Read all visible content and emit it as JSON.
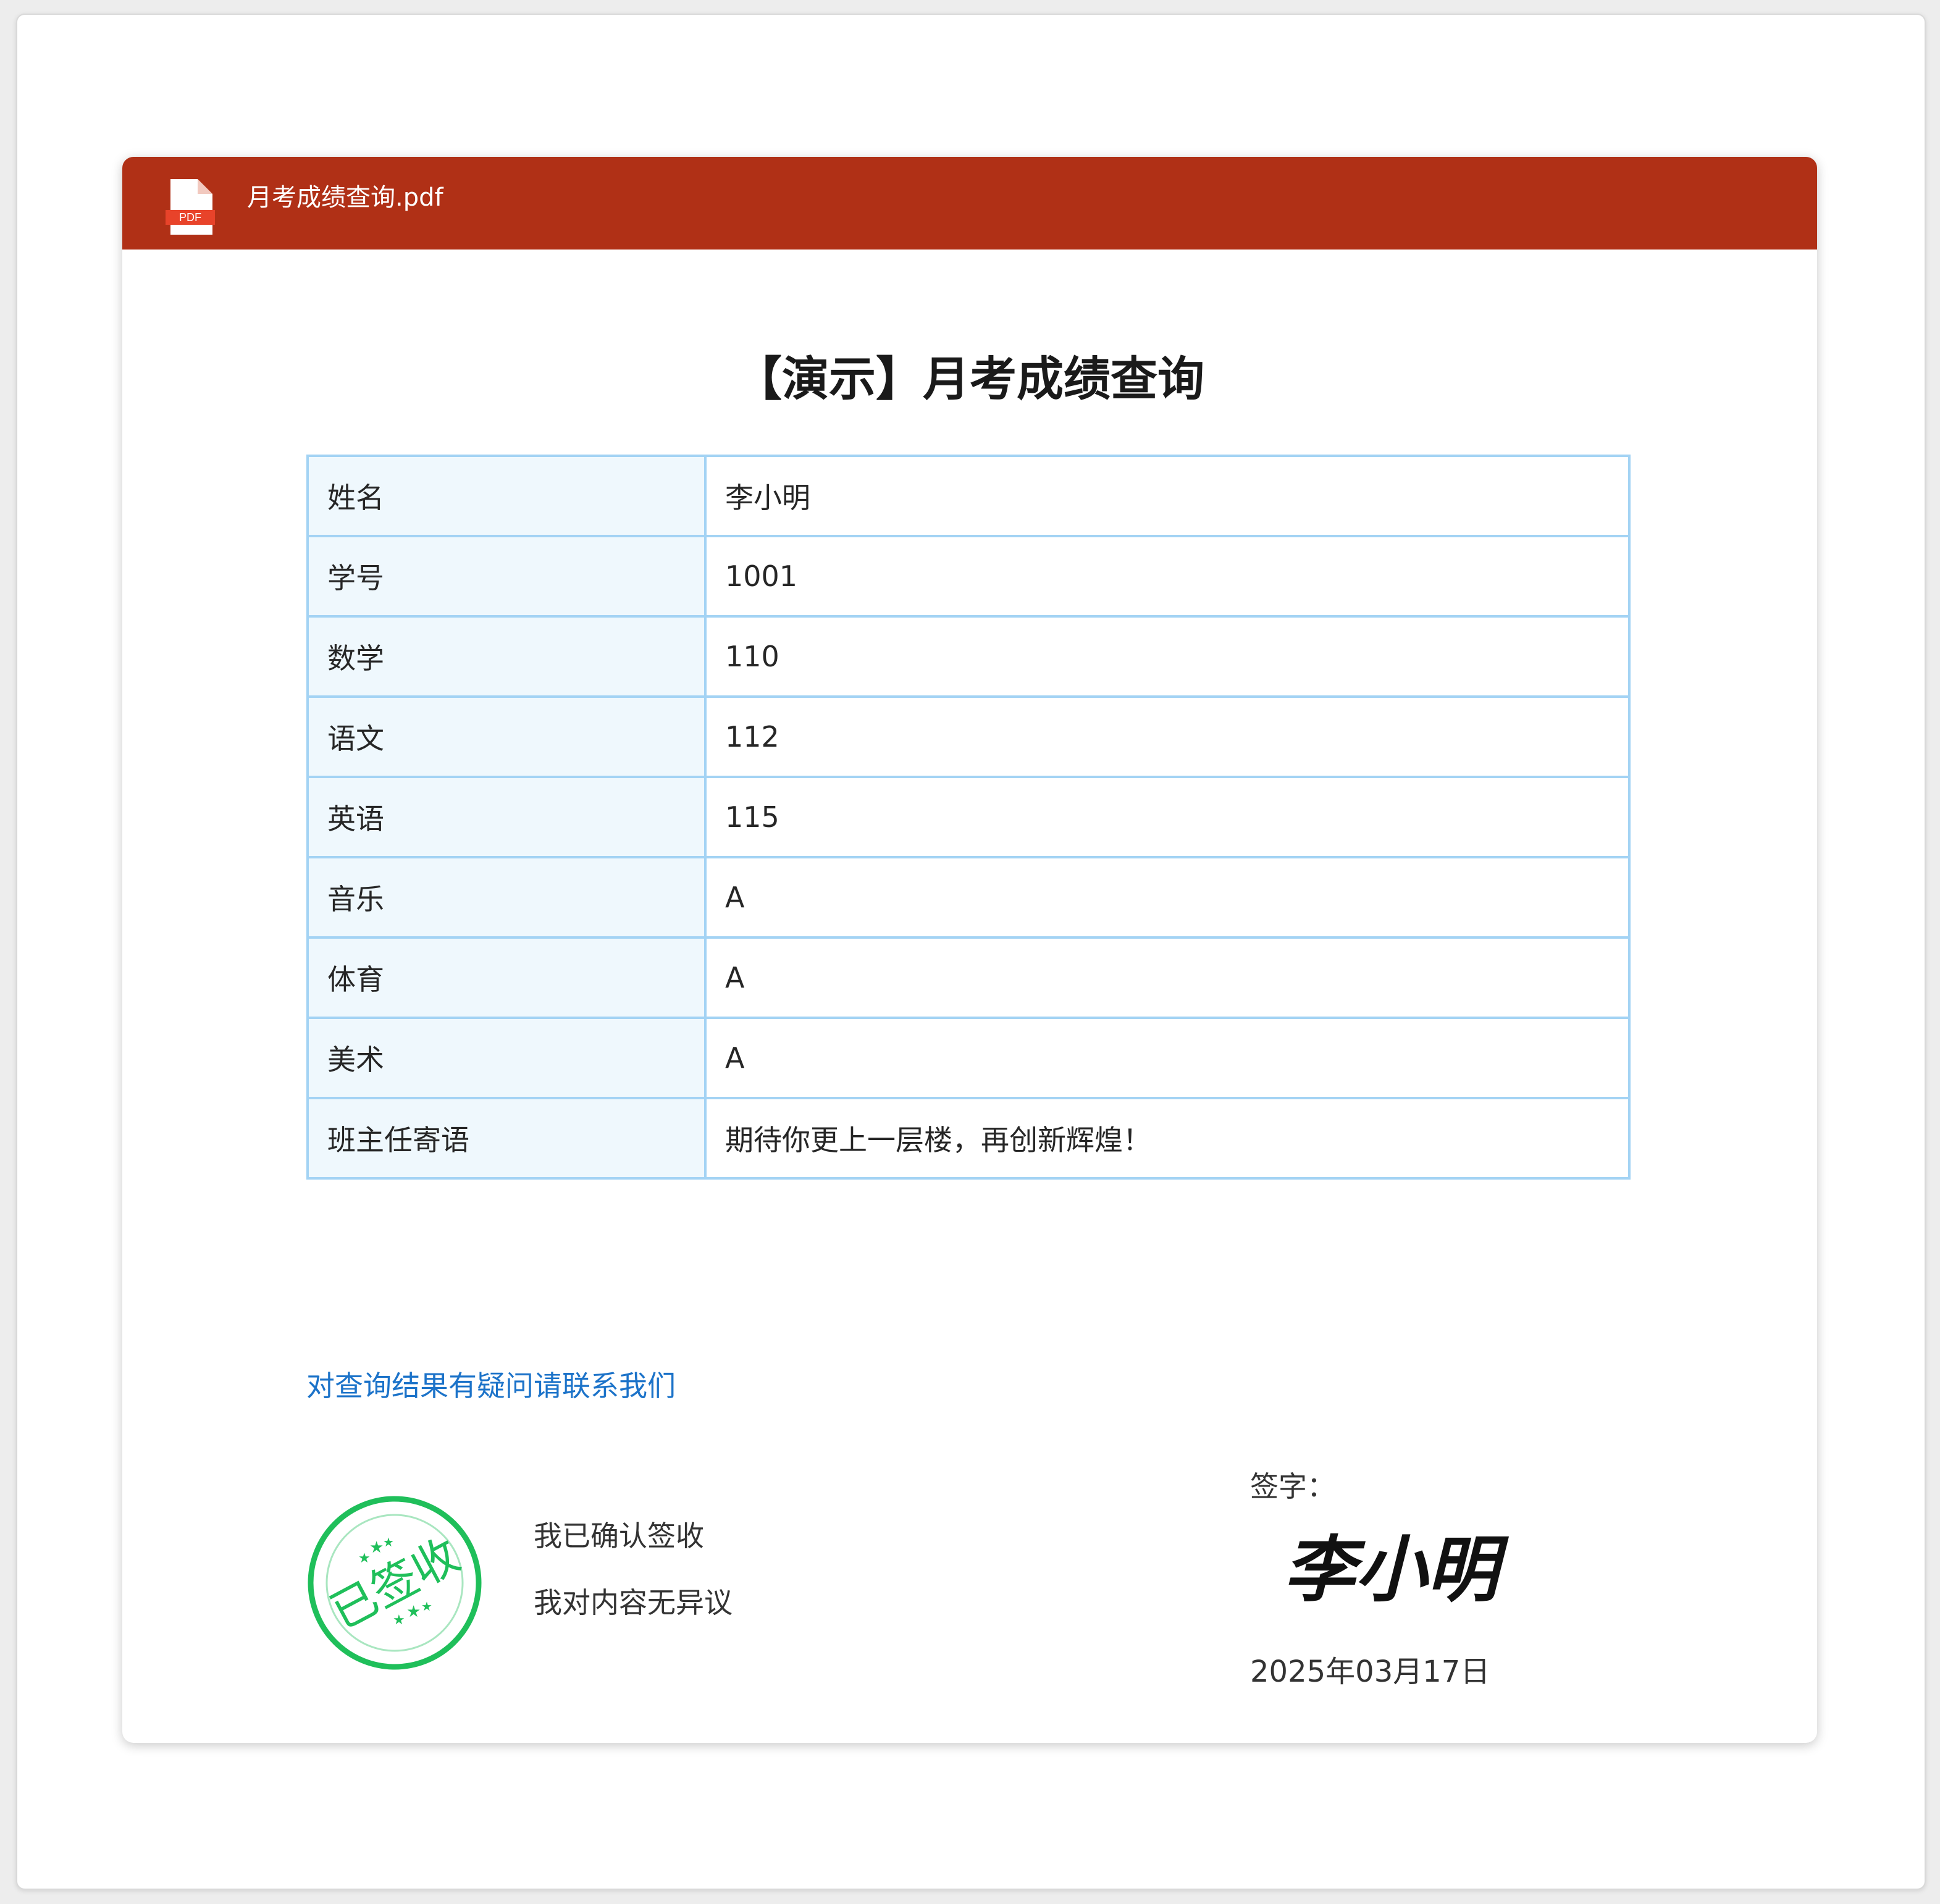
{
  "header": {
    "file_badge": "PDF",
    "filename": "月考成绩查询.pdf",
    "bar_color": "#b03016"
  },
  "document": {
    "title": "【演示】月考成绩查询",
    "rows": [
      {
        "label": "姓名",
        "value": "李小明"
      },
      {
        "label": "学号",
        "value": "1001"
      },
      {
        "label": "数学",
        "value": "110"
      },
      {
        "label": "语文",
        "value": "112"
      },
      {
        "label": "英语",
        "value": "115"
      },
      {
        "label": "音乐",
        "value": "A"
      },
      {
        "label": "体育",
        "value": "A"
      },
      {
        "label": "美术",
        "value": "A"
      },
      {
        "label": "班主任寄语",
        "value": "期待你更上一层楼，再创新辉煌！"
      }
    ],
    "contact_link": "对查询结果有疑问请联系我们",
    "stamp": {
      "text": "已签收",
      "color": "#1fbf5a",
      "icon": "received-stamp-icon"
    },
    "confirm_line_1": "我已确认签收",
    "confirm_line_2": "我对内容无异议",
    "sign_label": "签字：",
    "signature": {
      "text": "李小明",
      "icon": "handwritten-signature-icon"
    },
    "sign_date": "2025年03月17日"
  }
}
